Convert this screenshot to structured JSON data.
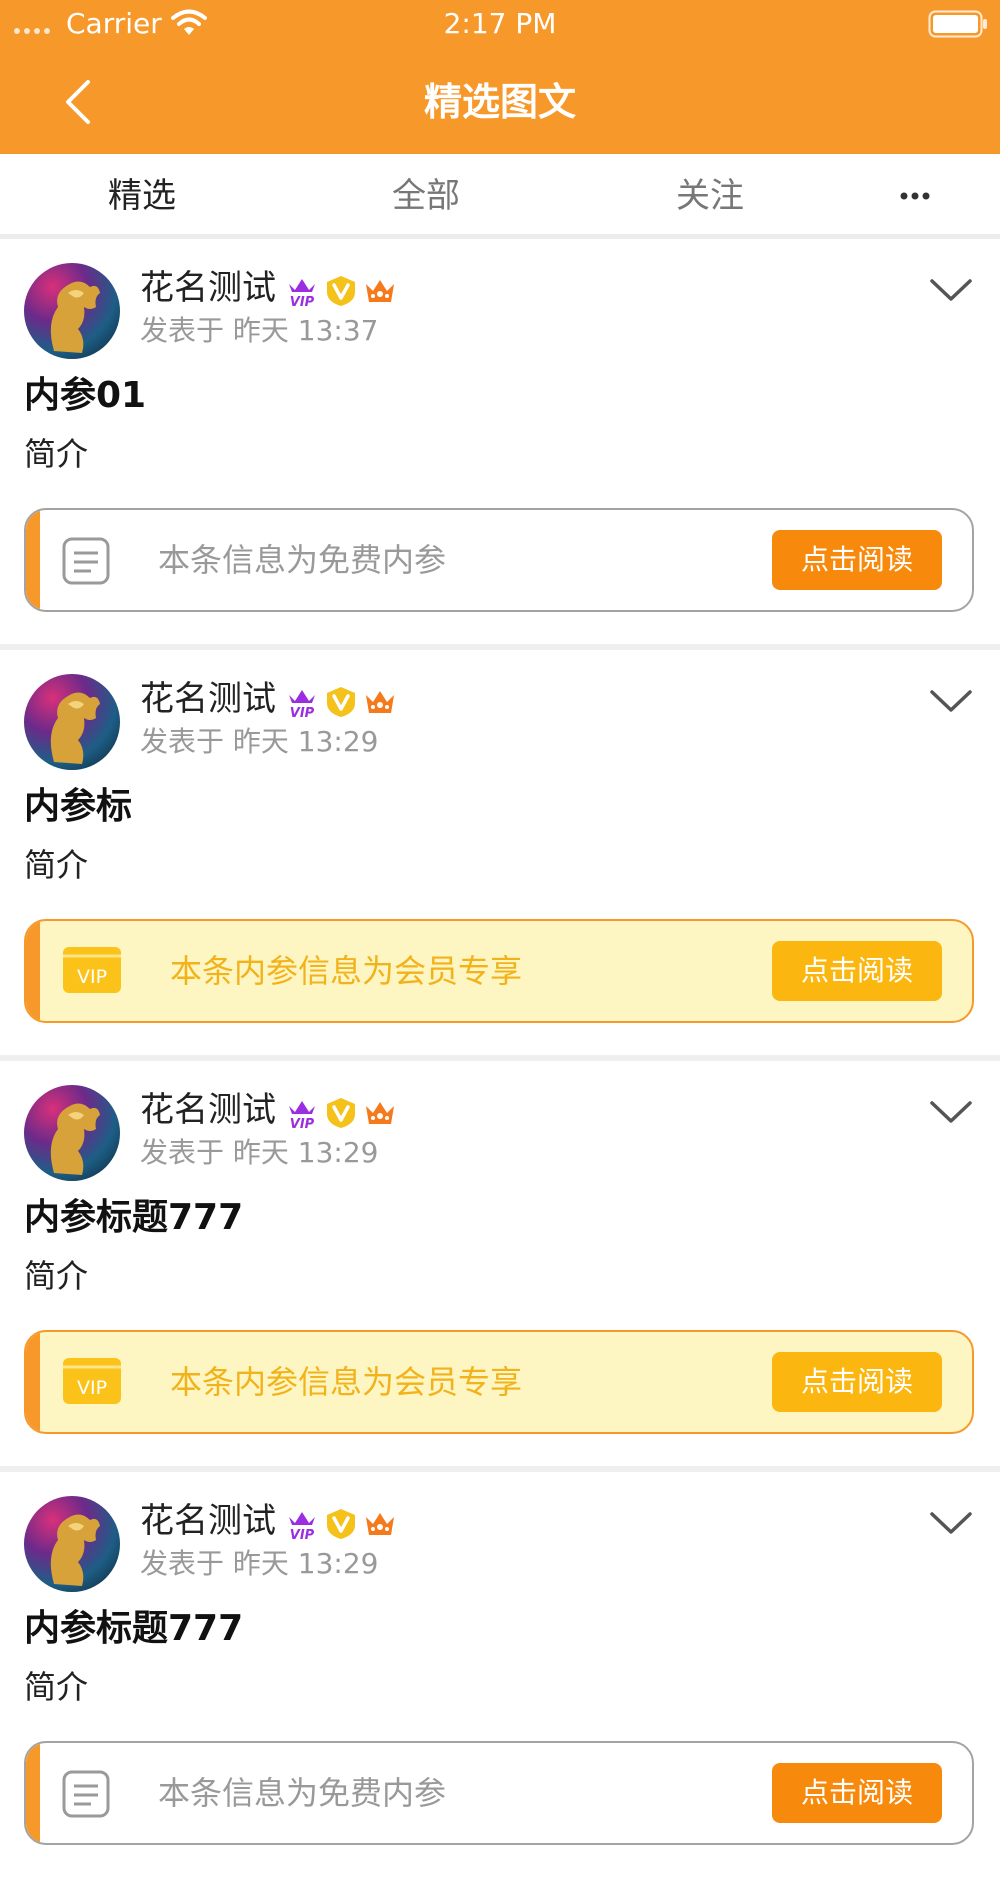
{
  "status_bar": {
    "carrier": "Carrier",
    "time": "2:17 PM"
  },
  "header": {
    "title": "精选图文",
    "background": "#f7982a"
  },
  "tabs": [
    {
      "label": "精选",
      "active": true
    },
    {
      "label": "全部",
      "active": false
    },
    {
      "label": "关注",
      "active": false
    }
  ],
  "tabs_more_icon": "more-dots-icon",
  "posts": [
    {
      "author": "花名测试",
      "badges": [
        "vip-crown-badge",
        "v-verified-badge",
        "crown-badge"
      ],
      "time": "发表于 昨天 13:37",
      "title": "内参01",
      "summary": "简介",
      "box_type": "free",
      "box_text": "本条信息为免费内参",
      "button": "点击阅读"
    },
    {
      "author": "花名测试",
      "badges": [
        "vip-crown-badge",
        "v-verified-badge",
        "crown-badge"
      ],
      "time": "发表于 昨天 13:29",
      "title": "内参标",
      "summary": "简介",
      "box_type": "vip",
      "box_icon_text": "VIP",
      "box_text": "本条内参信息为会员专享",
      "button": "点击阅读"
    },
    {
      "author": "花名测试",
      "badges": [
        "vip-crown-badge",
        "v-verified-badge",
        "crown-badge"
      ],
      "time": "发表于 昨天 13:29",
      "title": "内参标题777",
      "summary": "简介",
      "box_type": "vip",
      "box_icon_text": "VIP",
      "box_text": "本条内参信息为会员专享",
      "button": "点击阅读"
    },
    {
      "author": "花名测试",
      "badges": [
        "vip-crown-badge",
        "v-verified-badge",
        "crown-badge"
      ],
      "time": "发表于 昨天 13:29",
      "title": "内参标题777",
      "summary": "简介",
      "box_type": "free",
      "box_text": "本条信息为免费内参",
      "button": "点击阅读"
    }
  ],
  "colors": {
    "accent": "#f7982a",
    "tab_indicator": "#e8473d",
    "vip_box_bg": "#fdf6c2",
    "vip_text": "#f2b21b"
  }
}
